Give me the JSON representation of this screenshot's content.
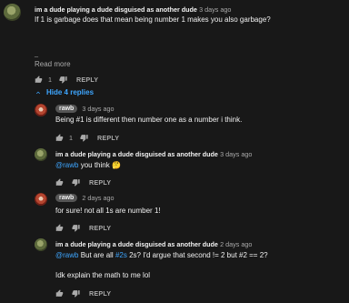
{
  "top_comment": {
    "author": "im a dude playing a dude disguised as another dude",
    "time": "3 days ago",
    "text": "If 1 is garbage does that mean being number 1 makes you also garbage?",
    "ellipsis": "_",
    "read_more": "Read more",
    "likes": "1",
    "reply_label": "REPLY"
  },
  "hide_replies_label": "Hide 4 replies",
  "replies": [
    {
      "author": "rawb",
      "time": "3 days ago",
      "text": "Being #1 is different then number one as a number i think.",
      "likes": "1",
      "reply_label": "REPLY"
    },
    {
      "author": "im a dude playing a dude disguised as another dude",
      "time": "3 days ago",
      "mention": "@rawb",
      "text": " you think ",
      "emoji": "🤔",
      "reply_label": "REPLY"
    },
    {
      "author": "rawb",
      "time": "2 days ago",
      "text": "for sure! not all 1s are number 1!",
      "reply_label": "REPLY"
    },
    {
      "author": "im a dude playing a dude disguised as another dude",
      "time": "2 days ago",
      "mention": "@rawb",
      "text_a": " But are all ",
      "hashtag": "#2s",
      "text_b": " 2s? I'd argue that second != 2 but #2 == 2?",
      "line2": "Idk explain the math to me lol",
      "reply_label": "REPLY"
    }
  ]
}
